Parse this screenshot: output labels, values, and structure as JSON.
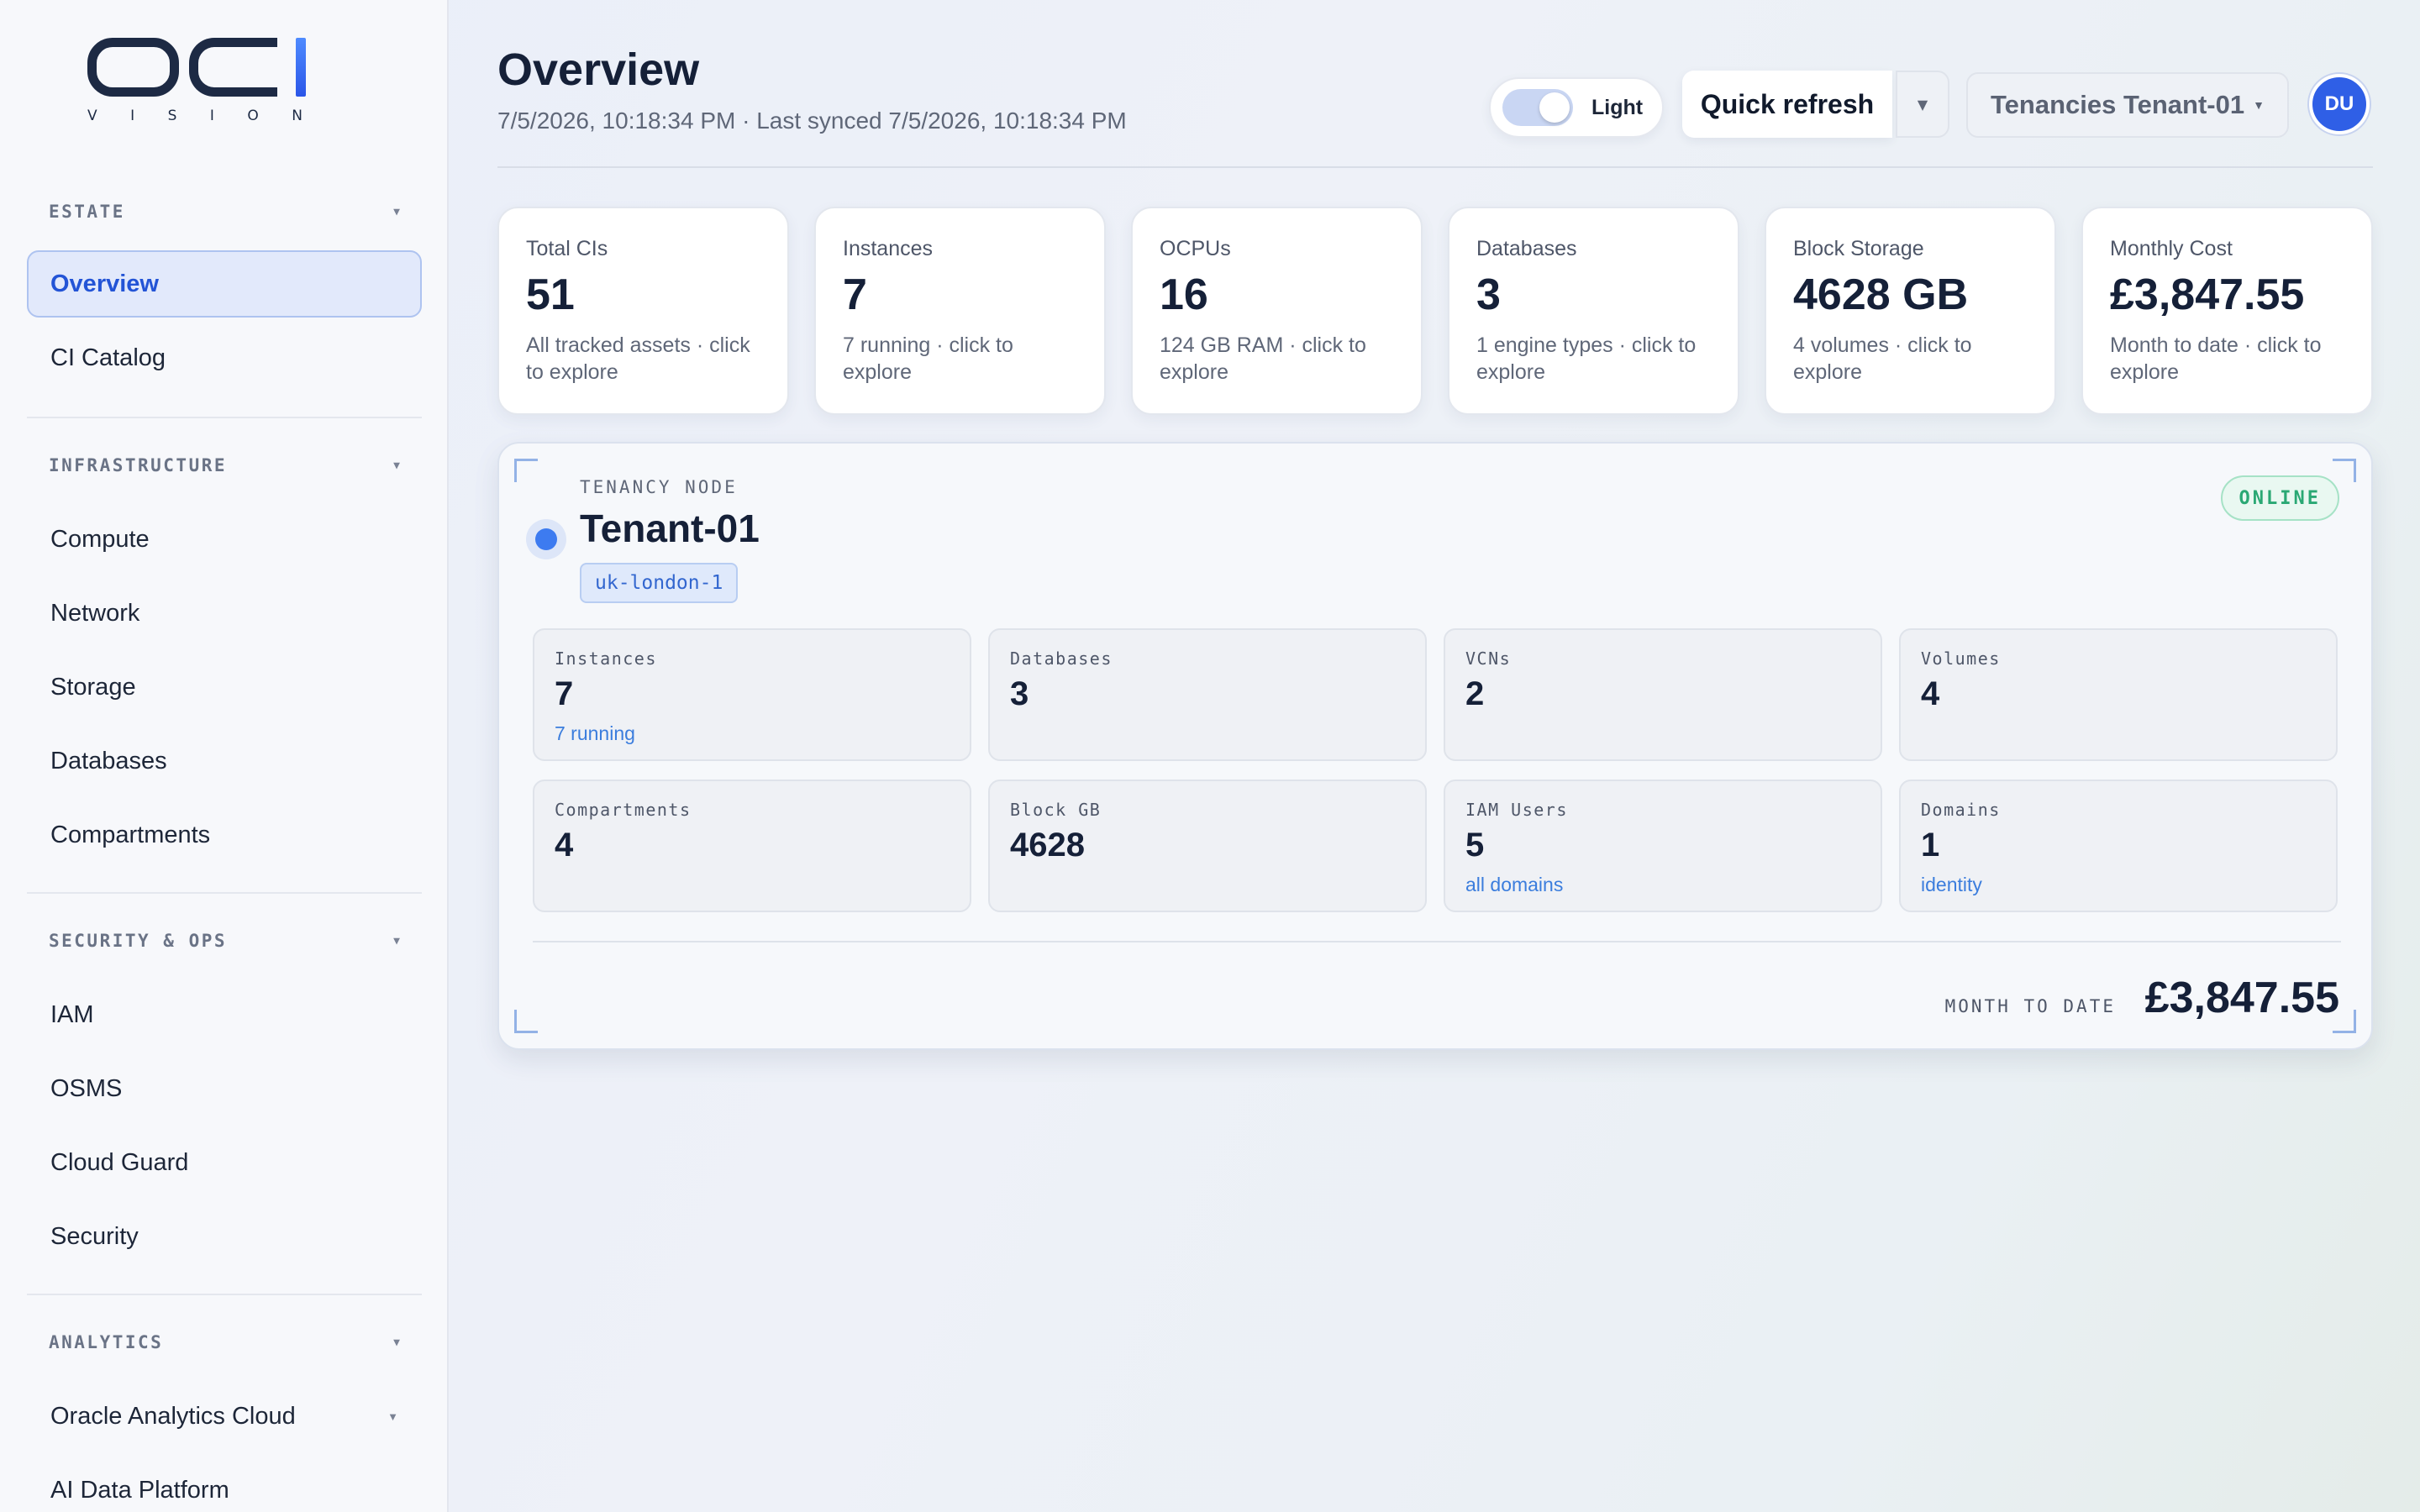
{
  "brand": {
    "logo_text": "OCI",
    "logo_sub": [
      "V",
      "I",
      "S",
      "I",
      "O",
      "N"
    ]
  },
  "sidebar": {
    "sections": [
      {
        "title": "ESTATE",
        "items": [
          {
            "label": "Overview",
            "active": true
          },
          {
            "label": "CI Catalog"
          }
        ]
      },
      {
        "title": "INFRASTRUCTURE",
        "items": [
          {
            "label": "Compute"
          },
          {
            "label": "Network"
          },
          {
            "label": "Storage"
          },
          {
            "label": "Databases"
          },
          {
            "label": "Compartments"
          }
        ]
      },
      {
        "title": "SECURITY & OPS",
        "items": [
          {
            "label": "IAM"
          },
          {
            "label": "OSMS"
          },
          {
            "label": "Cloud Guard"
          },
          {
            "label": "Security"
          }
        ]
      },
      {
        "title": "ANALYTICS",
        "items": [
          {
            "label": "Oracle Analytics Cloud"
          },
          {
            "label": "AI Data Platform"
          }
        ]
      }
    ]
  },
  "header": {
    "title": "Overview",
    "subtitle": "7/5/2026, 10:18:34 PM · Last synced 7/5/2026, 10:18:34 PM",
    "theme_label": "Light",
    "refresh_label": "Quick refresh",
    "tenancy_label": "Tenancies Tenant-01",
    "avatar_initials": "DU"
  },
  "kpis": [
    {
      "label": "Total CIs",
      "value": "51",
      "note": "All tracked assets · click to explore"
    },
    {
      "label": "Instances",
      "value": "7",
      "note": "7 running · click to explore"
    },
    {
      "label": "OCPUs",
      "value": "16",
      "note": "124 GB RAM · click to explore"
    },
    {
      "label": "Databases",
      "value": "3",
      "note": "1 engine types · click to explore"
    },
    {
      "label": "Block Storage",
      "value": "4628 GB",
      "note": "4 volumes · click to explore"
    },
    {
      "label": "Monthly Cost",
      "value": "£3,847.55",
      "note": "Month to date · click to explore"
    }
  ],
  "tenancy_node": {
    "kicker": "TENANCY NODE",
    "name": "Tenant-01",
    "region": "uk-london-1",
    "status": "ONLINE",
    "metrics": [
      {
        "label": "Instances",
        "value": "7",
        "note": "7 running"
      },
      {
        "label": "Databases",
        "value": "3",
        "note": ""
      },
      {
        "label": "VCNs",
        "value": "2",
        "note": ""
      },
      {
        "label": "Volumes",
        "value": "4",
        "note": ""
      },
      {
        "label": "Compartments",
        "value": "4",
        "note": ""
      },
      {
        "label": "Block GB",
        "value": "4628",
        "note": ""
      },
      {
        "label": "IAM Users",
        "value": "5",
        "note": "all domains"
      },
      {
        "label": "Domains",
        "value": "1",
        "note": "identity"
      }
    ],
    "mtd_label": "MONTH TO DATE",
    "mtd_value": "£3,847.55"
  },
  "colors": {
    "accent": "#2f5fe6",
    "online": "#2aa874",
    "link": "#3b7ddd"
  }
}
